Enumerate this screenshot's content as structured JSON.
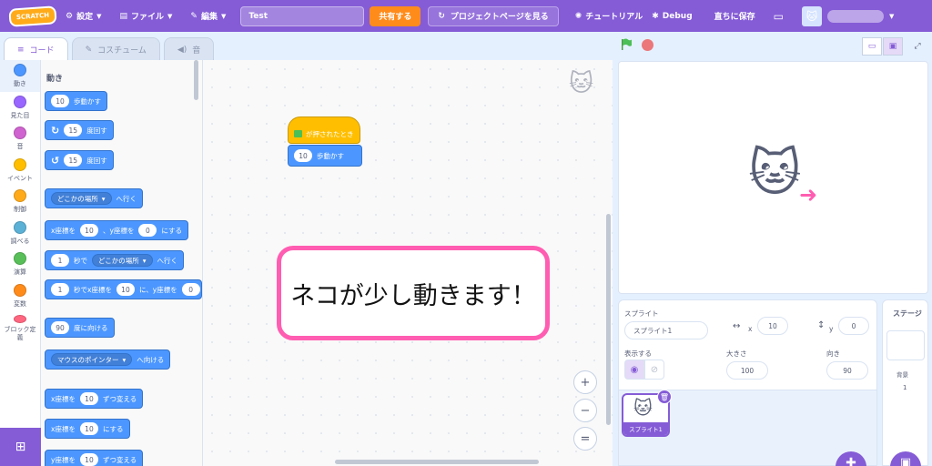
{
  "menubar": {
    "logo_text": "SCRATCH",
    "settings": "設定",
    "file": "ファイル",
    "edit": "編集",
    "project_title": "Test",
    "share": "共有する",
    "project_page": "プロジェクトページを見る",
    "tutorials": "チュートリアル",
    "debug": "Debug",
    "save_now": "直ちに保存"
  },
  "tabs": {
    "code": "コード",
    "costumes": "コスチューム",
    "sounds": "音"
  },
  "categories": [
    {
      "label": "動き",
      "color": "#4c97ff"
    },
    {
      "label": "見た目",
      "color": "#9966ff"
    },
    {
      "label": "音",
      "color": "#cf63cf"
    },
    {
      "label": "イベント",
      "color": "#ffbf00"
    },
    {
      "label": "制御",
      "color": "#ffab19"
    },
    {
      "label": "調べる",
      "color": "#5cb1d6"
    },
    {
      "label": "演算",
      "color": "#59c059"
    },
    {
      "label": "変数",
      "color": "#ff8c1a"
    },
    {
      "label": "ブロック定義",
      "color": "#ff6680"
    }
  ],
  "palette": {
    "heading": "動き",
    "move_steps": {
      "value": "10",
      "text": "歩動かす"
    },
    "turn_right": {
      "value": "15",
      "text": "度回す"
    },
    "turn_left": {
      "value": "15",
      "text": "度回す"
    },
    "goto_menu": {
      "option": "どこかの場所",
      "text": "へ行く"
    },
    "goto_xy": {
      "x_label": "x座標を",
      "x": "10",
      "y_label": "、y座標を",
      "y": "0",
      "text": "にする"
    },
    "glide_to": {
      "secs": "1",
      "mid": "秒で",
      "option": "どこかの場所",
      "text": "へ行く"
    },
    "glide_xy": {
      "secs": "1",
      "mid": "秒でx座標を",
      "x": "10",
      "mid2": "に、y座標を",
      "y": "0"
    },
    "point_dir": {
      "value": "90",
      "text": "度に向ける"
    },
    "point_towards": {
      "option": "マウスのポインター",
      "text": "へ向ける"
    },
    "change_x": {
      "label": "x座標を",
      "value": "10",
      "text": "ずつ変える"
    },
    "set_x": {
      "label": "x座標を",
      "value": "10",
      "text": "にする"
    },
    "change_y": {
      "label": "y座標を",
      "value": "10",
      "text": "ずつ変える"
    }
  },
  "script": {
    "hat_text": "が押されたとき",
    "move_value": "10",
    "move_text": "歩動かす"
  },
  "zoom": {
    "zoom_in": "+",
    "zoom_out": "−",
    "reset": "="
  },
  "callout": {
    "text": "ネコが少し動きます！"
  },
  "sprite_info": {
    "sprite_label": "スプライト",
    "sprite_name": "スプライト1",
    "x_label": "x",
    "x_value": "10",
    "y_label": "y",
    "y_value": "0",
    "show_label": "表示する",
    "size_label": "大きさ",
    "size_value": "100",
    "direction_label": "向き",
    "direction_value": "90"
  },
  "sprite_list": {
    "tile_name": "スプライト1"
  },
  "stage_panel": {
    "title": "ステージ",
    "backdrop_label": "背景",
    "backdrop_count": "1"
  },
  "colors": {
    "accent": "#855cd6",
    "motion": "#4c97ff",
    "events": "#ffbf00",
    "share": "#ff8c1a",
    "callout_border": "#ff5db1"
  }
}
